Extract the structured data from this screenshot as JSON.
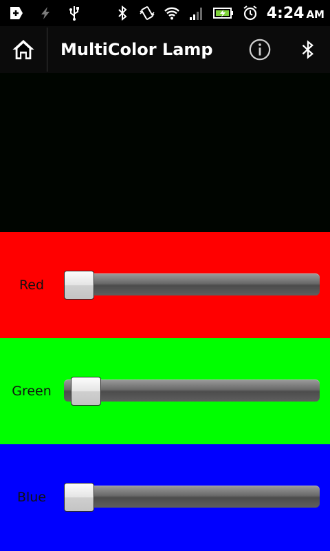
{
  "status_bar": {
    "time": "4:24",
    "ampm": "AM",
    "icons_left": [
      "notification-icon",
      "charging-bolt-icon",
      "usb-icon"
    ],
    "icons_right": [
      "bluetooth-icon",
      "vibrate-icon",
      "wifi-icon",
      "signal-icon",
      "battery-icon",
      "alarm-icon"
    ]
  },
  "action_bar": {
    "title": "MultiColor Lamp",
    "icons": [
      "home-icon",
      "info-icon",
      "bluetooth-icon"
    ]
  },
  "preview": {
    "color": "#000500"
  },
  "channels": [
    {
      "label": "Red",
      "background": "#ff0000",
      "value_fraction": 0.0
    },
    {
      "label": "Green",
      "background": "#00ff00",
      "value_fraction": 0.03
    },
    {
      "label": "Blue",
      "background": "#0000ff",
      "value_fraction": 0.0
    }
  ]
}
